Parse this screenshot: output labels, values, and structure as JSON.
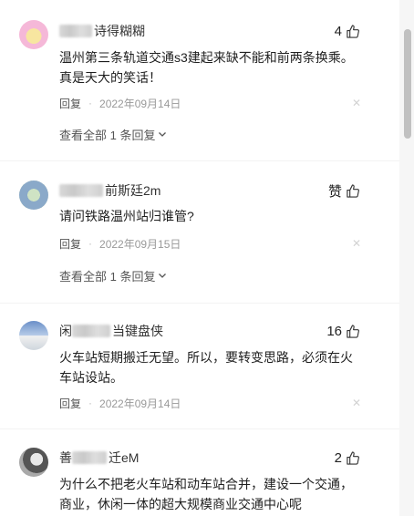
{
  "comments": [
    {
      "name_visible": "诗得糊糊",
      "likes": "4",
      "text": "温州第三条轨道交通s3建起来缺不能和前两条换乘。真是天大的笑话！",
      "reply_label": "回复",
      "date": "2022年09月14日",
      "view_all": "查看全部 1 条回复"
    },
    {
      "name_visible": "前斯廷2m",
      "likes": "赞",
      "text": "请问铁路温州站归谁管?",
      "reply_label": "回复",
      "date": "2022年09月15日",
      "view_all": "查看全部 1 条回复"
    },
    {
      "name_prefix": "闲",
      "name_visible": "当键盘侠",
      "likes": "16",
      "text": "火车站短期搬迁无望。所以，要转变思路，必须在火车站设站。",
      "reply_label": "回复",
      "date": "2022年09月14日"
    },
    {
      "name_prefix": "善",
      "name_visible": "迁eM",
      "likes": "2",
      "text": "为什么不把老火车站和动车站合并，建设一个交通，商业，休闲一体的超大规模商业交通中心呢"
    }
  ],
  "icons": {
    "like": "thumbs-up-icon",
    "close": "close-icon",
    "chevron": "chevron-down-icon"
  },
  "colors": {
    "text": "#1f1f1f",
    "meta": "#999999",
    "scroll_thumb": "#c1c1c1"
  }
}
